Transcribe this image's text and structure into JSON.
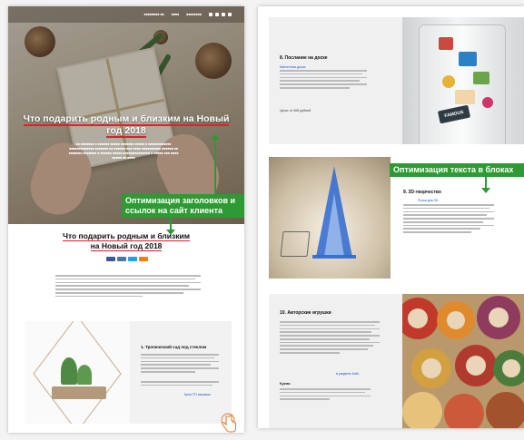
{
  "colors": {
    "accent_red": "#e41f26",
    "label_green": "#2d9a33",
    "link_blue": "#1a56c8"
  },
  "left": {
    "hero_title": "Что подарить родным и близким на Новый год 2018",
    "annotation": "Оптимизация заголовков и ссылок на сайт клиента",
    "section_title_line1": "Что подарить родным и близким",
    "section_title_line2": "на Новый год 2018",
    "card1_title": "1. Тропический сад под стеклом",
    "card1_link": "Купи ТП заказчик",
    "cursor_icon": "hand-pointer-icon"
  },
  "right": {
    "card8_title": "8. Послание на доске",
    "card8_link": "Магнитная доска",
    "card8_price": "Цена: от 305 рублей",
    "fridge_magnet": "FAMOUS",
    "annotation": "Оптимизация текста в блоках",
    "card9_title": "9. 3D-творчество",
    "card9_link": "Ручка для 3D",
    "card10_title": "10. Авторские игрушки",
    "card10_link": "в разделе Avito",
    "card10_sub": "Кукла"
  }
}
